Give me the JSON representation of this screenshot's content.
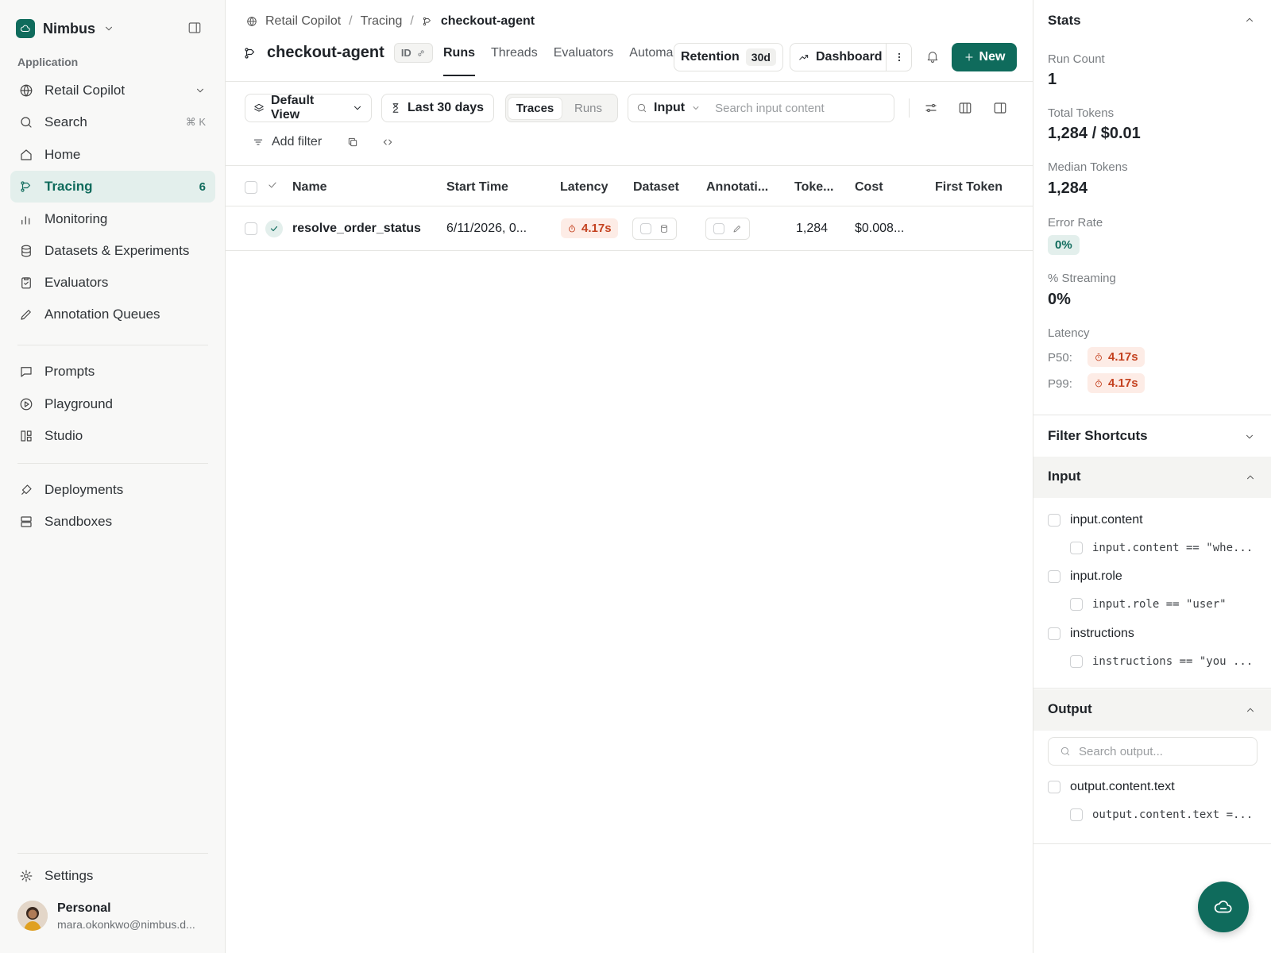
{
  "sidebar": {
    "workspace": "Nimbus",
    "section_label": "Application",
    "project": "Retail Copilot",
    "search": {
      "label": "Search",
      "shortcut": "⌘ K"
    },
    "items": [
      {
        "label": "Home"
      },
      {
        "label": "Tracing",
        "count": "6"
      },
      {
        "label": "Monitoring"
      },
      {
        "label": "Datasets & Experiments"
      },
      {
        "label": "Evaluators"
      },
      {
        "label": "Annotation Queues"
      },
      {
        "label": "Prompts"
      },
      {
        "label": "Playground"
      },
      {
        "label": "Studio"
      },
      {
        "label": "Deployments"
      },
      {
        "label": "Sandboxes"
      }
    ],
    "settings": "Settings",
    "user": {
      "name": "Personal",
      "email": "mara.okonkwo@nimbus.d..."
    }
  },
  "breadcrumb": [
    "Retail Copilot",
    "Tracing",
    "checkout-agent"
  ],
  "header": {
    "title": "checkout-agent",
    "id_label": "ID",
    "tabs": [
      "Runs",
      "Threads",
      "Evaluators",
      "Automa"
    ],
    "retention_label": "Retention",
    "retention_value": "30d",
    "dashboard_label": "Dashboard",
    "new_label": "New"
  },
  "toolbar": {
    "view": "Default View",
    "time_range": "Last 30 days",
    "segment": [
      "Traces",
      "Runs"
    ],
    "search_field": "Input",
    "search_placeholder": "Search input content",
    "add_filter": "Add filter"
  },
  "table": {
    "columns": [
      "Name",
      "Start Time",
      "Latency",
      "Dataset",
      "Annotati...",
      "Toke...",
      "Cost",
      "First Token"
    ],
    "rows": [
      {
        "name": "resolve_order_status",
        "start_time": "6/11/2026, 0...",
        "latency": "4.17s",
        "tokens": "1,284",
        "cost": "$0.008..."
      }
    ]
  },
  "stats": {
    "title": "Stats",
    "run_count_label": "Run Count",
    "run_count": "1",
    "total_tokens_label": "Total Tokens",
    "total_tokens": "1,284 / $0.01",
    "median_tokens_label": "Median Tokens",
    "median_tokens": "1,284",
    "error_rate_label": "Error Rate",
    "error_rate": "0%",
    "streaming_label": "% Streaming",
    "streaming": "0%",
    "latency_label": "Latency",
    "p50_label": "P50:",
    "p50": "4.17s",
    "p99_label": "P99:",
    "p99": "4.17s"
  },
  "filters": {
    "title": "Filter Shortcuts",
    "input_title": "Input",
    "input_items": [
      "input.content",
      "input.content == \"whe...",
      "input.role",
      "input.role == \"user\"",
      "instructions",
      "instructions == \"you ..."
    ],
    "output_title": "Output",
    "output_search_placeholder": "Search output...",
    "output_items": [
      "output.content.text",
      "output.content.text =..."
    ]
  },
  "colors": {
    "accent": "#0f6b5c",
    "latency": "#c4411f"
  }
}
